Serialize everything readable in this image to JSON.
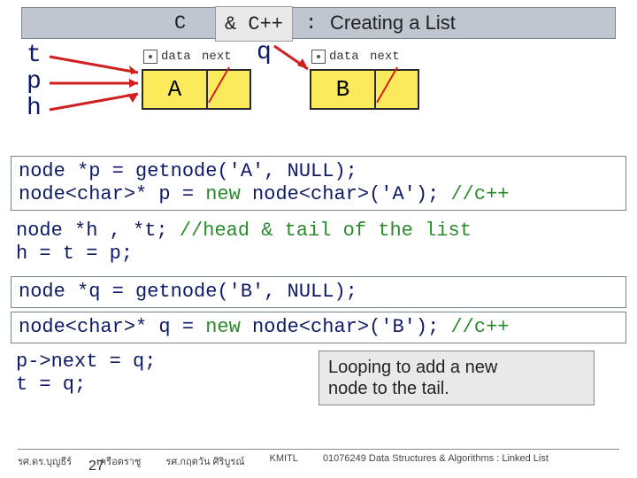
{
  "header": {
    "c": "C",
    "cpp": "& C++",
    "colon": ":",
    "title": "Creating a List"
  },
  "ptrs": {
    "t": "t",
    "p": "p",
    "h": "h",
    "q": "q"
  },
  "nodelbl": {
    "data": "data",
    "next": "next"
  },
  "nodes": {
    "a": "A",
    "b": "B"
  },
  "code1a": "node *p = getnode('A', NULL);",
  "code1b_pre": "node<char>* p = ",
  "code1b_mid": "new",
  "code1b_post": " node<char>('A'); ",
  "code1b_cmt": "//c++",
  "line2a_pre": "node *h , *t; ",
  "line2a_cmt": "//head & tail of the list",
  "line2b": "h = t = p;",
  "code3": "node *q = getnode('B', NULL);",
  "code4_pre": "node<char>* q = ",
  "code4_mid": "new",
  "code4_post": " node<char>('B'); ",
  "code4_cmt": "//c++",
  "line5a": "p->next = q;",
  "line5b": "t = q;",
  "note1": "Looping to add a new",
  "note2": "node to the tail.",
  "footer": {
    "a": "รศ.ดร.บุญธีร์",
    "b": "เครือตราชู",
    "c": "รศ.กฤตวัน  ศิริบูรณ์",
    "d": "KMITL",
    "e": "01076249 Data Structures & Algorithms  : Linked List"
  },
  "slidenum": "27"
}
